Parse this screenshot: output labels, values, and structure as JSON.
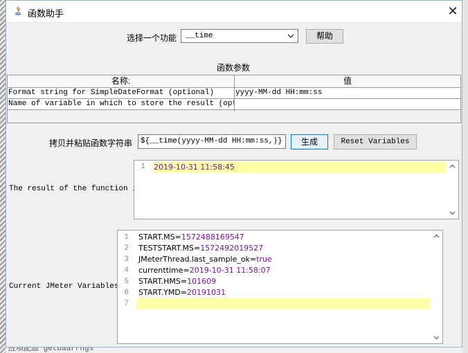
{
  "window": {
    "title": "函数助手"
  },
  "function_select": {
    "label": "选择一个功能",
    "value": "__time",
    "help_label": "帮助"
  },
  "params": {
    "section_title": "函数参数",
    "headers": [
      "名称:",
      "值"
    ],
    "rows": [
      {
        "name": "Format string for SimpleDateFormat (optional)",
        "value": "yyyy-MM-dd HH:mm:ss"
      },
      {
        "name": "Name of variable in which to store the result (opti...",
        "value": ""
      }
    ]
  },
  "copy_paste": {
    "label": "拷贝并粘贴函数字符串",
    "value": "${__time(yyyy-MM-dd HH:mm:ss,)}",
    "generate_label": "生成",
    "reset_label": "Reset Variables"
  },
  "result": {
    "label": "The result of the function is",
    "lines": [
      {
        "no": "1",
        "text": "2019-10-31 11:58:45"
      }
    ]
  },
  "variables": {
    "label": "Current JMeter Variables",
    "lines": [
      {
        "no": "1",
        "key": "START.MS=",
        "val": "1572488169547"
      },
      {
        "no": "2",
        "key": "TESTSTART.MS=",
        "val": "1572492019527"
      },
      {
        "no": "3",
        "key": "JMeterThread.last_sample_ok=",
        "val": "true"
      },
      {
        "no": "4",
        "key": "currenttime=",
        "val": "2019-10-31 11:58:07"
      },
      {
        "no": "5",
        "key": "START.HMS=",
        "val": "101609"
      },
      {
        "no": "6",
        "key": "START.YMD=",
        "val": "20191031"
      },
      {
        "no": "7",
        "key": "",
        "val": ""
      }
    ]
  },
  "background": {
    "bottom_text": "应项配血 getbaarrngs"
  },
  "colors": {
    "highlight": "#ffffa8",
    "value_purple": "#7a10a8",
    "focus_blue": "#0078d7"
  }
}
